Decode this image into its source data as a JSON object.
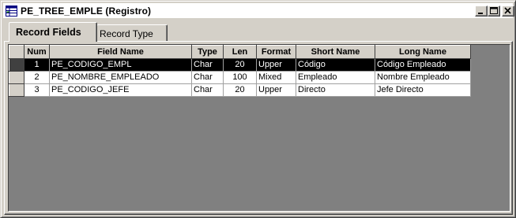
{
  "window": {
    "title": "PE_TREE_EMPLE (Registro)",
    "icon": "record-grid-icon"
  },
  "tabs": [
    {
      "label": "Record Fields",
      "active": true
    },
    {
      "label": "Record Type",
      "active": false
    }
  ],
  "grid": {
    "columns": [
      "Num",
      "Field Name",
      "Type",
      "Len",
      "Format",
      "Short Name",
      "Long Name"
    ],
    "rows": [
      {
        "num": "1",
        "field_name": "PE_CODIGO_EMPL",
        "type": "Char",
        "len": "20",
        "format": "Upper",
        "short_name": "Código",
        "long_name": "Código Empleado",
        "selected": true
      },
      {
        "num": "2",
        "field_name": "PE_NOMBRE_EMPLEADO",
        "type": "Char",
        "len": "100",
        "format": "Mixed",
        "short_name": "Empleado",
        "long_name": "Nombre Empleado",
        "selected": false
      },
      {
        "num": "3",
        "field_name": "PE_CODIGO_JEFE",
        "type": "Char",
        "len": "20",
        "format": "Upper",
        "short_name": "Directo",
        "long_name": "Jefe Directo",
        "selected": false
      }
    ]
  },
  "colors": {
    "chrome": "#d4d0c8",
    "selected_row": "#000000",
    "grid_background": "#808080"
  }
}
